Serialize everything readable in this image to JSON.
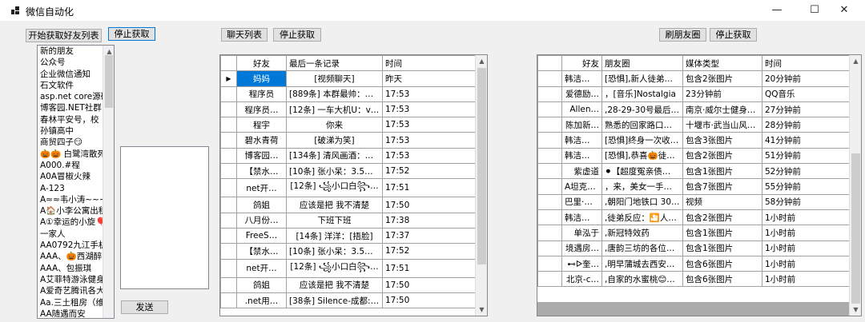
{
  "window": {
    "title": "微信自动化",
    "minimize": "—",
    "maximize": "☐",
    "close": "✕"
  },
  "friends_panel": {
    "start_button": "开始获取好友列表",
    "stop_button": "停止获取",
    "send_button": "发送",
    "items": [
      "新的朋友",
      "公众号",
      "企业微信通知",
      "石文软件",
      "asp.net core源码",
      "博客园.NET社群",
      "春林平安号，校",
      "孙镇高中",
      "商贸四子😏",
      "🎃🎃 白鹭湾散死",
      "A000.#程",
      "A0A冒椒火辣",
      "A-123",
      "A≈≈韦小涛~~~",
      "A🏠小李公寓出租",
      "A①幸运的小旋🎈",
      "一家人",
      "AA0792九江手机",
      "AAA、🎃西湖醉沽",
      "AAA、包振琪",
      "A艾菲特游泳健身-",
      "A爱奇艺腾讯各大鼎",
      "Aa.三土租房（维构",
      "AA随遇而安"
    ]
  },
  "chat_panel": {
    "list_button": "聊天列表",
    "stop_button": "停止获取",
    "headers": [
      "好友",
      "最后一条记录",
      "时间"
    ],
    "rows": [
      [
        "妈妈",
        "[视频聊天]",
        "昨天"
      ],
      [
        "程序员",
        "[889条] 本群最帅：服…",
        "17:53"
      ],
      [
        "程序员…",
        "[12条] 一车大机U：vs …",
        "17:53"
      ],
      [
        "程宇",
        "你来",
        "17:53"
      ],
      [
        "碧水青荷",
        "[破涕为笑]",
        "17:53"
      ],
      [
        "博客园…",
        "[134条] 清风画酒：我…",
        "17:53"
      ],
      [
        "【禁水…",
        "[10条] 张小呆：3.5应该…",
        "17:52"
      ],
      [
        "net开…",
        "[12条] ꧁小口白꧂…",
        "17:51"
      ],
      [
        "鸽姐",
        "应该是把 我不清楚",
        "17:50"
      ],
      [
        "八月份…",
        "下班下班",
        "17:38"
      ],
      [
        "FreeS…",
        "[14条] 洋洋：[捂脸]",
        "17:37"
      ],
      [
        "【禁水…",
        "[10条] 张小呆：3.5应该…",
        "17:52"
      ],
      [
        "net开…",
        "[12条] ꧁小口白꧂…",
        "17:51"
      ],
      [
        "鸽姐",
        "应该是把 我不清楚",
        "17:50"
      ],
      [
        ".net用…",
        "[38条] Silence-成都: …",
        "17:50"
      ]
    ]
  },
  "moments_panel": {
    "refresh_button": "刷朋友圈",
    "stop_button": "停止获取",
    "headers": [
      "好友",
      "朋友圈",
      "媒体类型",
      "时间"
    ],
    "rows": [
      [
        "韩洁🎃…",
        "[恐惧],新人徒弟入…",
        "包含2张图片",
        "20分钟前"
      ],
      [
        "爱德励…",
        "，[音乐]Nostalgia",
        "23分钟前",
        "QQ音乐"
      ],
      [
        "Allen…",
        ",28-29-30号最后3…",
        "南京·威尔士健身…",
        "27分钟前"
      ],
      [
        "陈加新…",
        "熟悉的回家路口🛄…",
        "十堰市·武当山风…",
        "28分钟前"
      ],
      [
        "韩洁🎃…",
        "[恐惧]终身一次收…",
        "包含3张图片",
        "41分钟前"
      ],
      [
        "韩洁🎃…",
        "[恐惧],恭喜🎃徒弟…",
        "包含2张图片",
        "51分钟前"
      ],
      [
        "紫虚道",
        "⚫【超度冤亲债…",
        "包含1张图片",
        "52分钟前"
      ],
      [
        "A坦克🚗…",
        "，来，美女一手车 1…",
        "包含7张图片",
        "55分钟前"
      ],
      [
        "巴里·艾…",
        ",朝阳门地铁口 300…",
        "视频",
        "58分钟前"
      ],
      [
        "韩洁🎃…",
        ",徒弟反应：🎦人…",
        "包含2张图片",
        "1小时前"
      ],
      [
        "单泓于",
        ",新冠特效药",
        "包含1张图片",
        "1小时前"
      ],
      [
        "境遇房…",
        ",唐韵三坊的各位租…",
        "包含1张图片",
        "1小时前"
      ],
      [
        "⊷ᐅ奎…",
        ",明早蒲城去西安！…",
        "包含6张图片",
        "1小时前"
      ],
      [
        "北京-c…",
        ",自家的水蜜桃😊…",
        "包含6张图片",
        "1小时前"
      ]
    ]
  }
}
